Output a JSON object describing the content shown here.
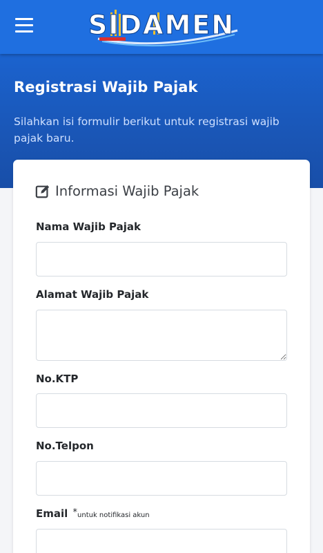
{
  "header": {
    "logo_text": "SIDAMEN",
    "menu_icon": "hamburger-menu-icon",
    "background_color": "#1f6fe0"
  },
  "hero": {
    "title": "Registrasi Wajib Pajak",
    "subtitle": "Silahkan isi formulir berikut untuk registrasi wajib pajak baru."
  },
  "form": {
    "section_title": "Informasi Wajib Pajak",
    "section_icon": "edit-icon",
    "fields": {
      "nama": {
        "label": "Nama Wajib Pajak",
        "value": ""
      },
      "alamat": {
        "label": "Alamat Wajib Pajak",
        "value": ""
      },
      "ktp": {
        "label": "No.KTP",
        "value": ""
      },
      "telpon": {
        "label": "No.Telpon",
        "value": ""
      },
      "email": {
        "label": "Email",
        "required_mark": "*",
        "note": "untuk notifikasi akun",
        "value": ""
      }
    }
  }
}
